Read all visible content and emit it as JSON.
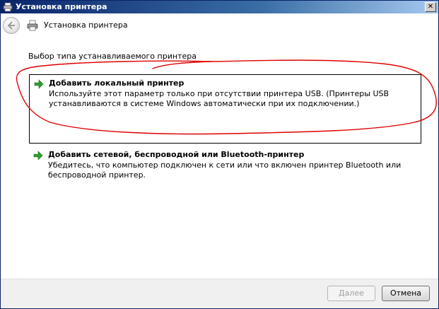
{
  "window": {
    "title": "Установка принтера"
  },
  "nav": {
    "title": "Установка принтера"
  },
  "main": {
    "heading": "Выбор типа устанавливаемого принтера",
    "options": [
      {
        "title": "Добавить локальный принтер",
        "description": "Используйте этот параметр только при отсутствии принтера USB. (Принтеры USB устанавливаются в системе Windows автоматически при их подключении.)",
        "selected": true
      },
      {
        "title": "Добавить сетевой, беспроводной или Bluetooth-принтер",
        "description": "Убедитесь, что компьютер подключен к сети или что включен принтер Bluetooth или беспроводной принтер.",
        "selected": false
      }
    ]
  },
  "footer": {
    "next_label": "Далее",
    "next_enabled": false,
    "cancel_label": "Отмена"
  },
  "colors": {
    "titlebar_start": "#0a246a",
    "annotation_red": "#e00000",
    "arrow_green": "#2e9e2e"
  },
  "icons": {
    "title": "printer-icon",
    "back": "back-arrow-icon",
    "nav": "printer-icon",
    "option": "green-arrow-icon",
    "close": "close-icon"
  }
}
